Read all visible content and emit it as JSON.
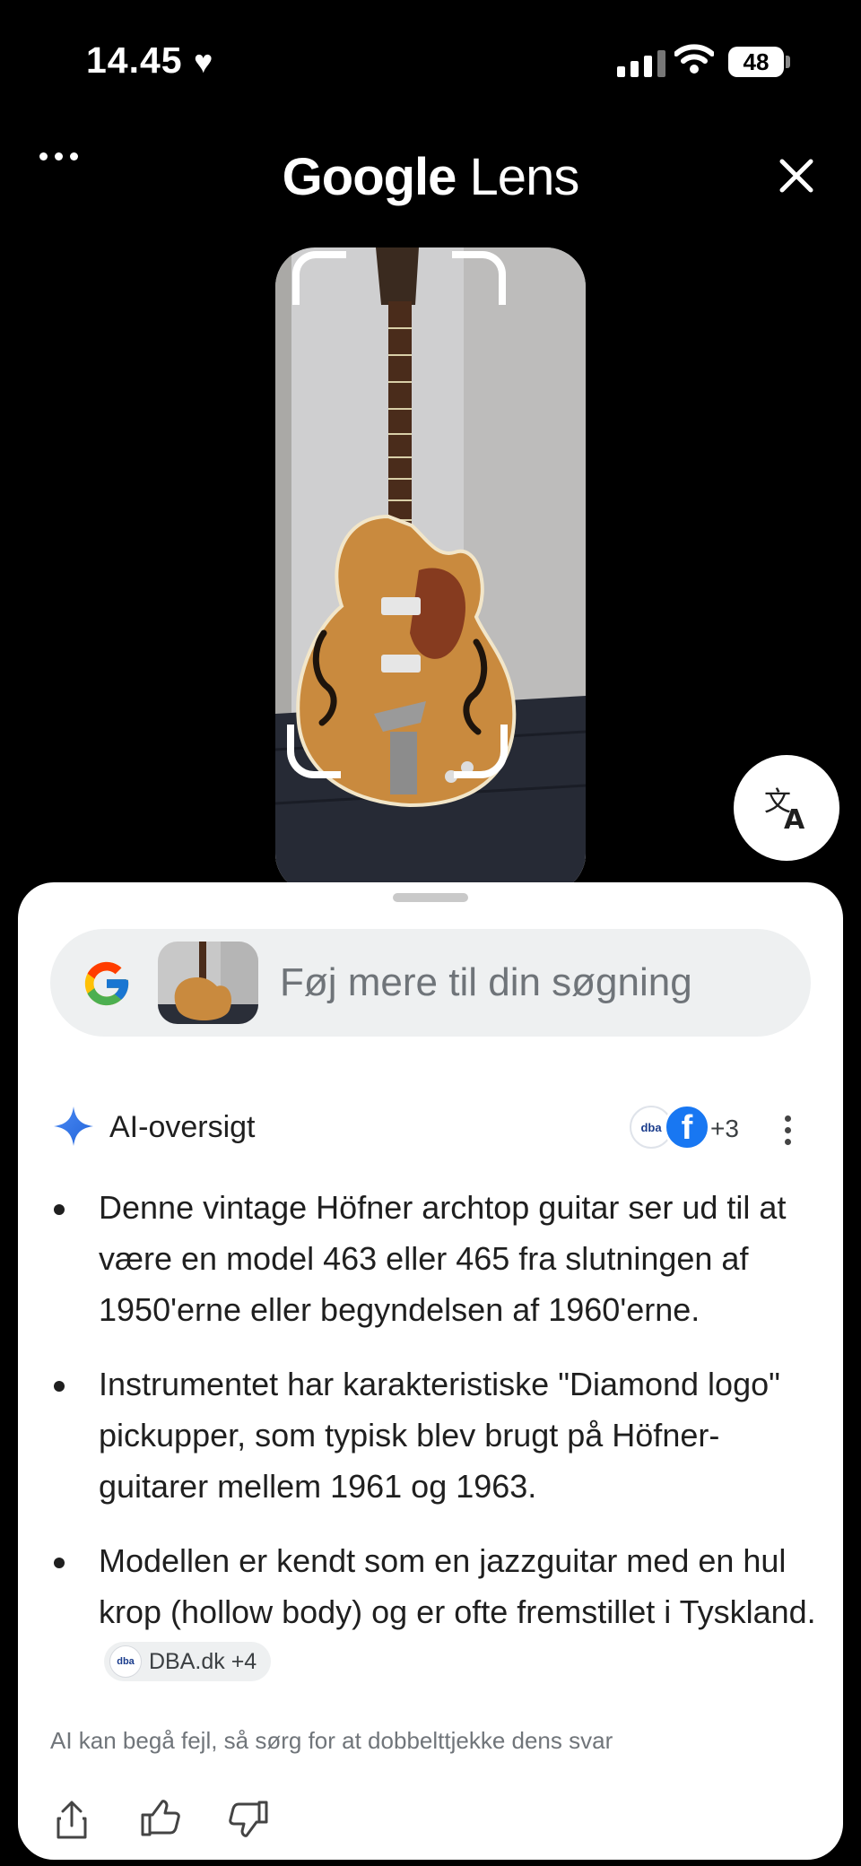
{
  "status_bar": {
    "time": "14.45",
    "battery": "48"
  },
  "header": {
    "title_brand": "Google",
    "title_product": " Lens"
  },
  "search": {
    "placeholder": "Føj mere til din søgning"
  },
  "ai_overview": {
    "title": "AI-oversigt",
    "source_logo": "dba",
    "source_count": "+3",
    "bullets": [
      "Denne vintage Höfner archtop guitar ser ud til at være en model 463 eller 465 fra slutningen af 1950'erne eller begyndelsen af 1960'erne.",
      "Instrumentet har karakteristiske \"Diamond logo\" pickupper, som typisk blev brugt på Höfner-guitarer mellem 1961 og 1963.",
      "Modellen er kendt som en jazzguitar med en hul krop (hollow body) og er ofte fremstillet i Tyskland."
    ],
    "citation": {
      "logo": "dba",
      "label": "DBA.dk +4"
    },
    "disclaimer": "AI kan begå fejl, så sørg for at dobbelttjekke dens svar"
  },
  "icons": [
    "heart-icon",
    "signal-icon",
    "wifi-icon",
    "more-icon",
    "close-icon",
    "translate-icon",
    "google-logo-icon",
    "sparkle-icon",
    "facebook-icon",
    "share-icon",
    "thumbs-up-icon",
    "thumbs-down-icon"
  ]
}
